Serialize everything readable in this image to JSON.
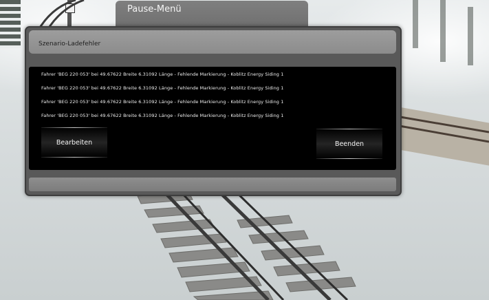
{
  "pause_menu": {
    "title": "Pause-Menü"
  },
  "dialog": {
    "title": "Szenario-Ladefehler",
    "messages": [
      "Fahrer 'BEG 220 053' bei 49.67622 Breite 6.31092 Länge - Fehlende Markierung - Koblitz Energy Siding 1",
      "Fahrer 'BEG 220 053' bei 49.67622 Breite 6.31092 Länge - Fehlende Markierung - Koblitz Energy Siding 1",
      "Fahrer 'BEG 220 053' bei 49.67622 Breite 6.31092 Länge - Fehlende Markierung - Koblitz Energy Siding 1",
      "Fahrer 'BEG 220 053' bei 49.67622 Breite 6.31092 Länge - Fehlende Markierung - Koblitz Energy Siding 1"
    ],
    "edit_label": "Bearbeiten",
    "quit_label": "Beenden"
  },
  "colors": {
    "panel": "#595959",
    "panel_header": "#9d9d9d",
    "body": "#000000",
    "text_light": "#f0f0f0"
  }
}
